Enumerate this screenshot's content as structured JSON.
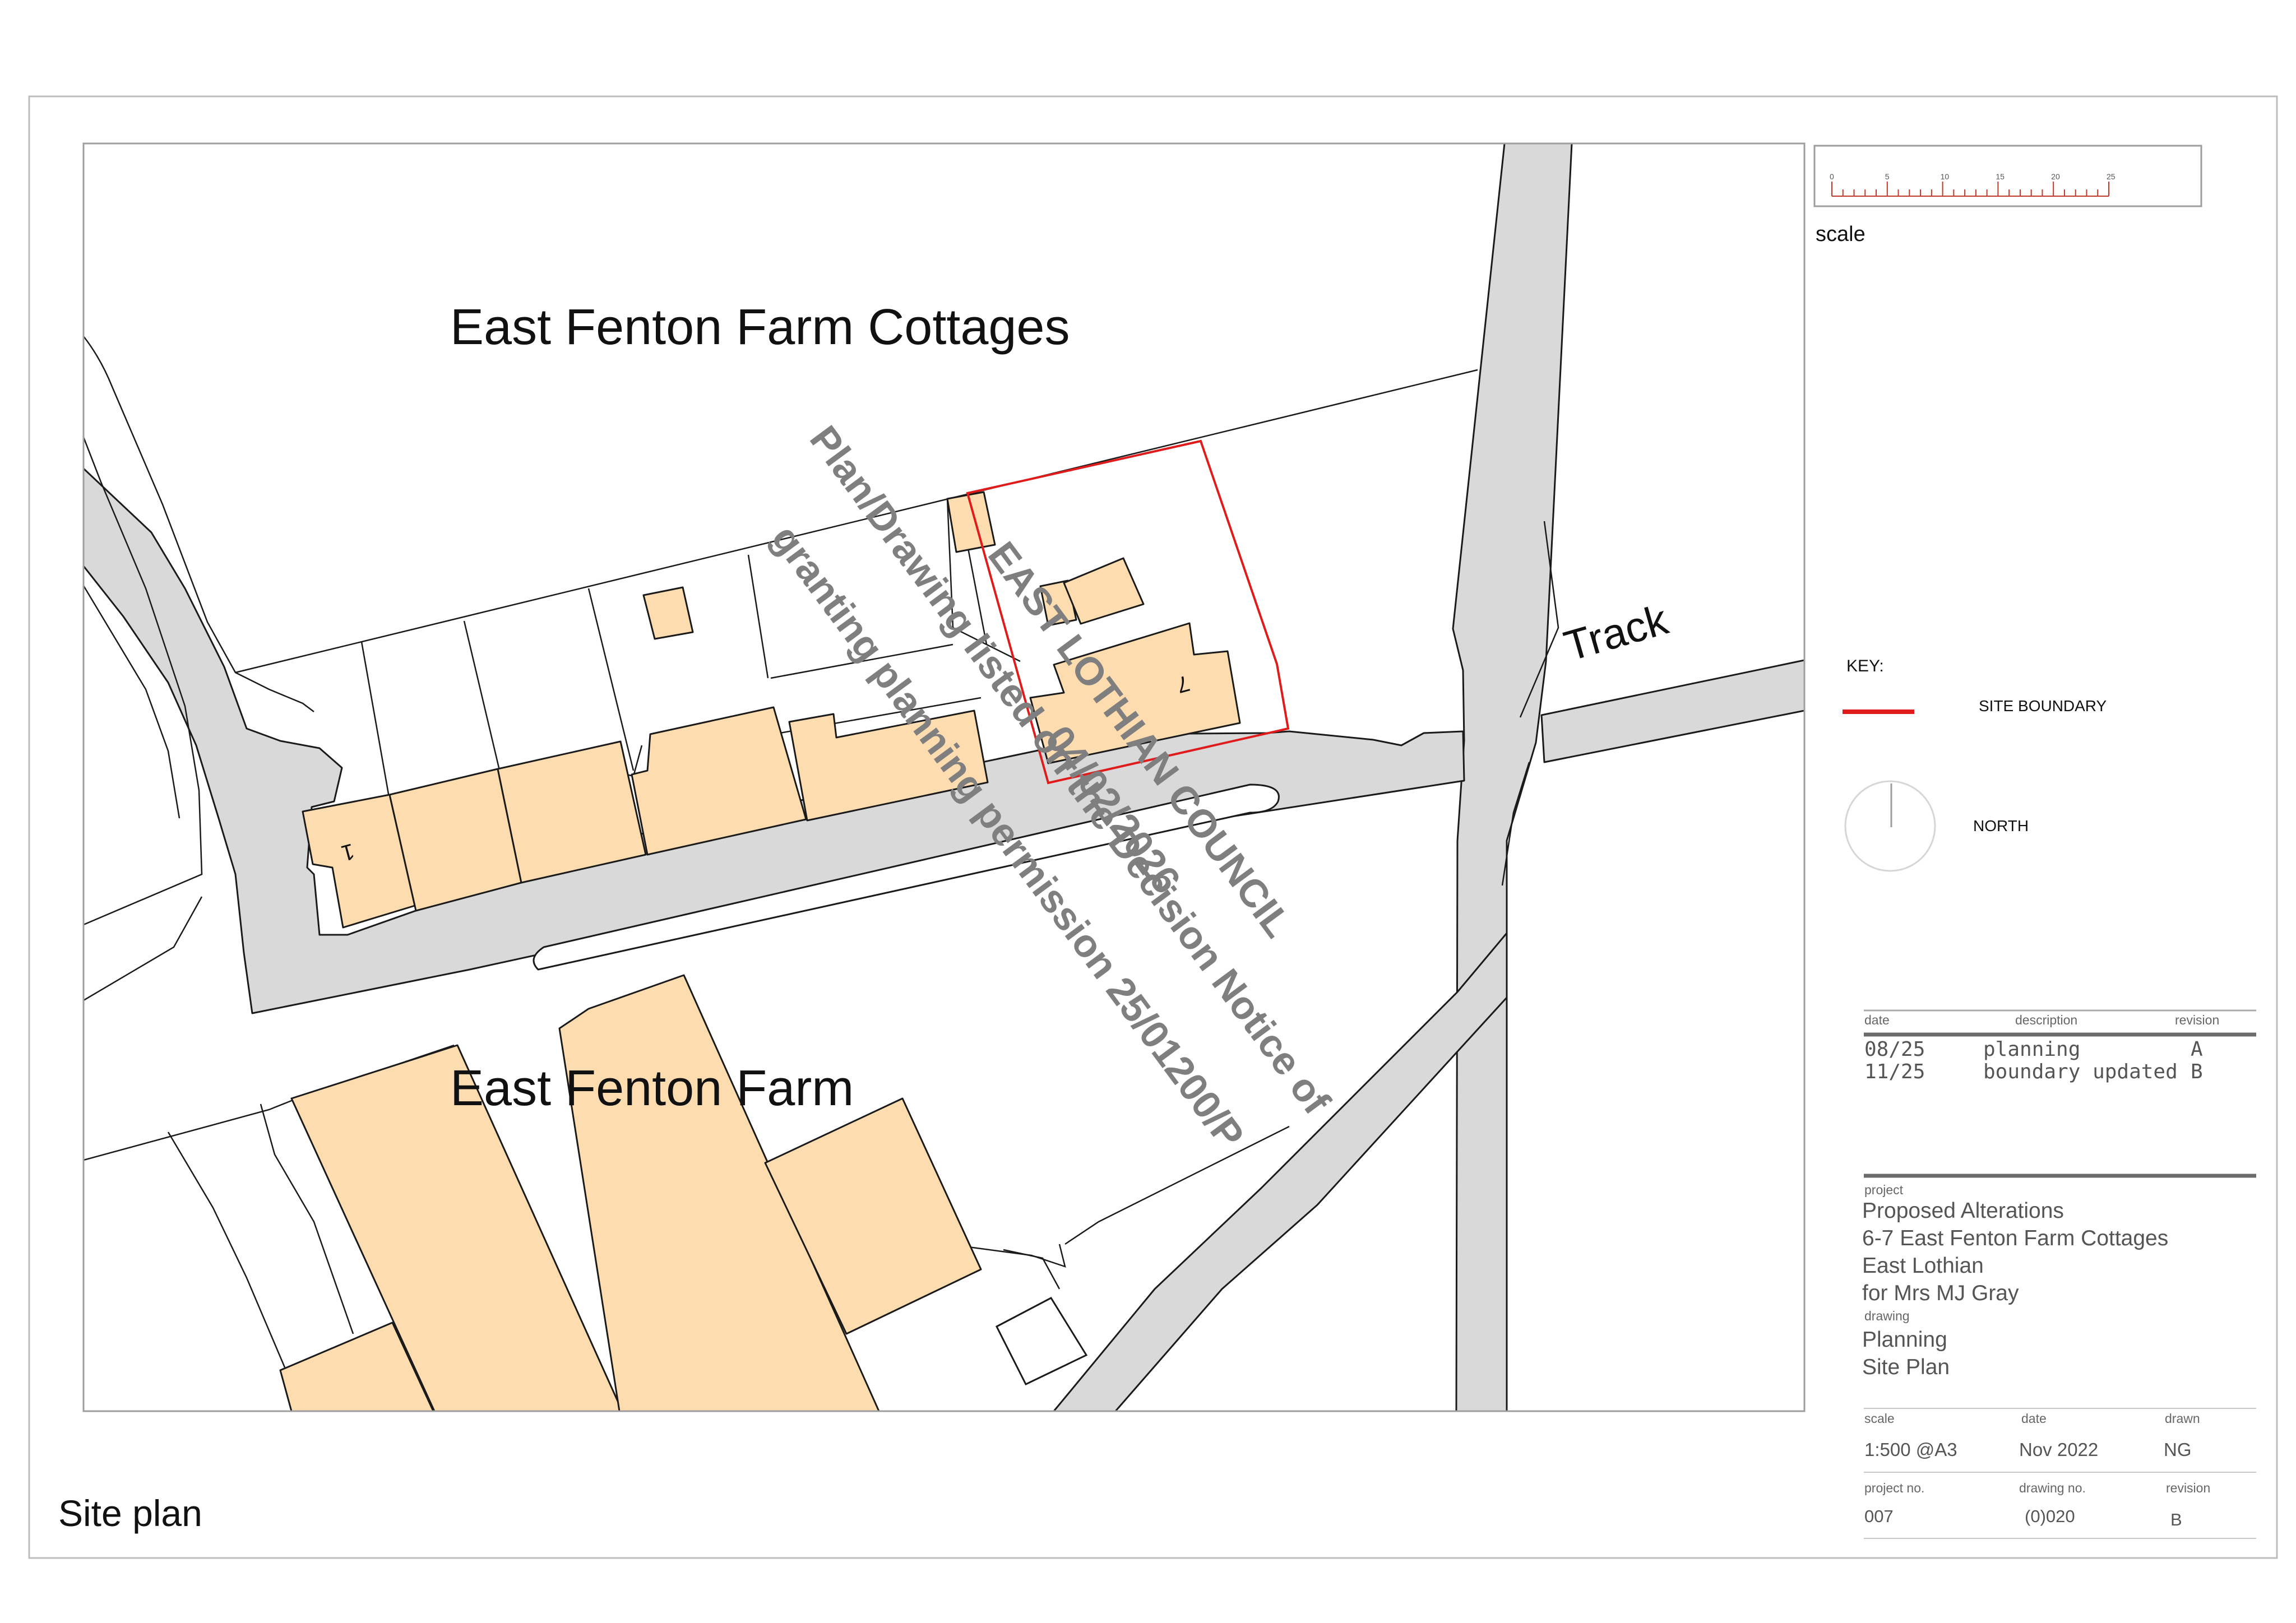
{
  "map": {
    "area_labels": {
      "cottages": "East Fenton Farm Cottages",
      "farm": "East Fenton Farm",
      "track": "Track"
    },
    "house_numbers": {
      "first": "1",
      "seventh": "7"
    },
    "colors": {
      "building_fill": "#fddcb0",
      "road_fill": "#d9d9d9",
      "site_boundary": "#e01b1b",
      "watermark": "#7f7f7f",
      "line": "#1a1a1a"
    }
  },
  "watermark": {
    "line1": "EAST LOTHIAN COUNCIL",
    "line2": "Plan/Drawing listed on the Decision Notice of",
    "line3": "granting planning permission 25/01200/P",
    "line4": "04/02/2026"
  },
  "scale_bar": {
    "label": "scale",
    "ticks": [
      "0",
      "5",
      "10",
      "15",
      "20",
      "25"
    ]
  },
  "key": {
    "title": "KEY:",
    "site_boundary": "SITE BOUNDARY",
    "north": "NORTH"
  },
  "revisions": {
    "headers": {
      "date": "date",
      "description": "description",
      "revision": "revision"
    },
    "rows": [
      {
        "date": "08/25",
        "description": "planning",
        "revision": "A"
      },
      {
        "date": "11/25",
        "description": "boundary updated",
        "revision": "B"
      }
    ]
  },
  "title_block": {
    "project_label": "project",
    "project_lines": [
      "Proposed Alterations",
      "6-7 East Fenton Farm Cottages",
      "East Lothian",
      "for Mrs MJ Gray"
    ],
    "drawing_label": "drawing",
    "drawing_lines": [
      "Planning",
      "Site Plan"
    ],
    "scale_label": "scale",
    "scale_value": "1:500 @A3",
    "date_label": "date",
    "date_value": "Nov 2022",
    "drawn_label": "drawn",
    "drawn_value": "NG",
    "project_no_label": "project no.",
    "project_no_value": "007",
    "drawing_no_label": "drawing no.",
    "drawing_no_value": "(0)020",
    "revision_label": "revision",
    "revision_value": "B"
  },
  "sheet_title": "Site plan"
}
